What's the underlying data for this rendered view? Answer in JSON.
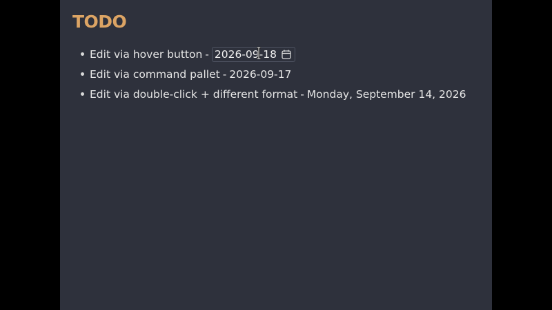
{
  "editor": {
    "heading": "TODO",
    "items": [
      {
        "label": "Edit via hover button",
        "separator": "-",
        "date": "2026-09-18",
        "date_editor_active": true,
        "calendar_icon": "calendar-icon"
      },
      {
        "label": "Edit via command pallet",
        "separator": "-",
        "date": "2026-09-17"
      },
      {
        "label": "Edit via double-click + different format",
        "separator": "-",
        "date": "Monday, September 14, 2026"
      }
    ]
  },
  "colors": {
    "background": "#2e313c",
    "heading": "#dca464",
    "text": "#e6e6e6",
    "outer": "#000000"
  }
}
